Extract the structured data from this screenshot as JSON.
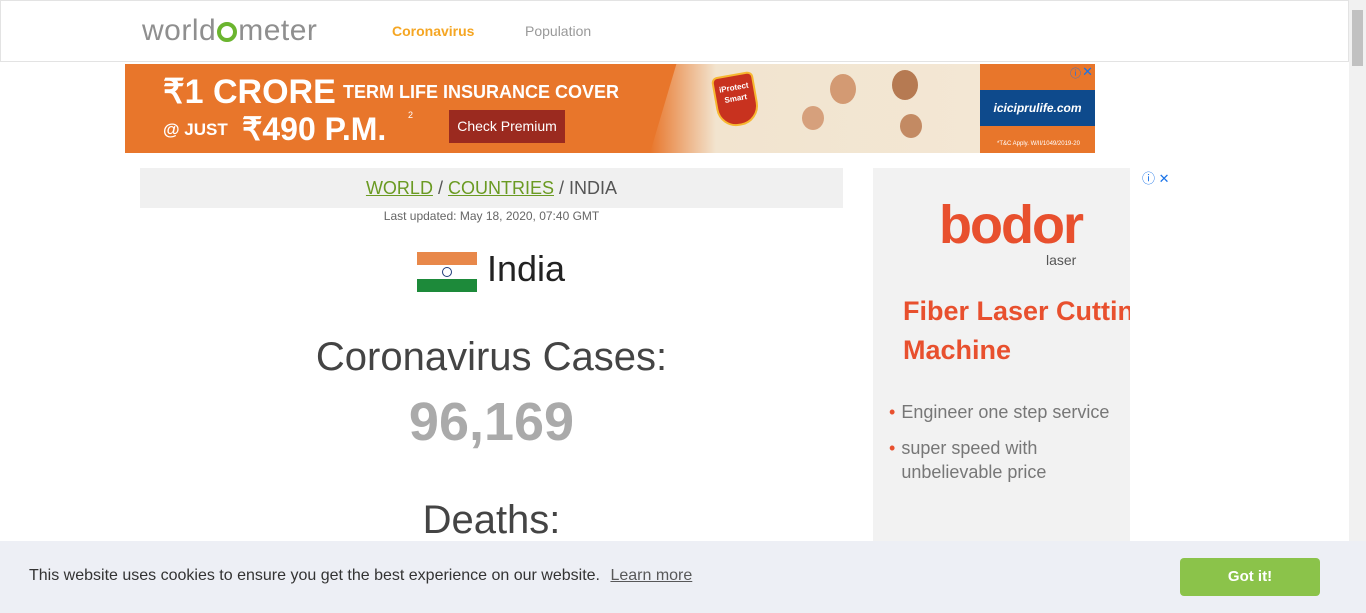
{
  "nav": {
    "logo": "worldometer",
    "links": [
      "Coronavirus",
      "Population"
    ]
  },
  "top_ad": {
    "headline_amount": "₹1 CRORE",
    "headline_text": "TERM LIFE INSURANCE COVER",
    "at_just": "@ JUST",
    "price": "₹490 P.M.",
    "price_sup": "2",
    "cta": "Check Premium",
    "badge": "iProtect Smart",
    "site": "iciciprulife.com",
    "tc": "*T&C Apply. W/II/1049/2019-20"
  },
  "breadcrumb": {
    "world": "WORLD",
    "countries": "COUNTRIES",
    "sep": "/",
    "current": "INDIA"
  },
  "last_updated": "Last updated: May 18, 2020, 07:40 GMT",
  "country": "India",
  "stats": {
    "cases_label": "Coronavirus Cases:",
    "cases_value": "96,169",
    "deaths_label": "Deaths:"
  },
  "side_ad": {
    "brand": "bodor",
    "brand_sub": "laser",
    "headline": "Fiber Laser Cutting Machine",
    "bullet1": "Engineer one step service",
    "bullet2": "super speed with unbelievable price"
  },
  "cookie": {
    "message": "This website uses cookies to ensure you get the best experience on our website.",
    "learn_more": "Learn more",
    "button": "Got it!"
  },
  "colors": {
    "accent_orange": "#f5a623",
    "logo_green": "#6bb52f",
    "link_green": "#6a9a22",
    "cookie_button": "#8bc34a"
  }
}
